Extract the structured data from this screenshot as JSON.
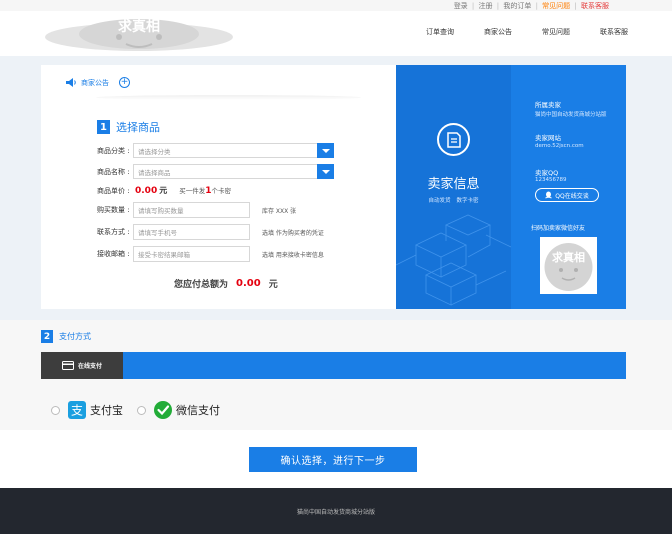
{
  "topbar": {
    "links": [
      "登录",
      "注册",
      "我的订单",
      "常见问题",
      "联系客服"
    ],
    "separator": "|"
  },
  "header": {
    "logo_text": "求真相",
    "nav": [
      "订单查询",
      "商家公告",
      "常见问题",
      "联系客服"
    ]
  },
  "notice": {
    "label": "商家公告",
    "plus": "+"
  },
  "step1": {
    "number": "1",
    "title": "选择商品",
    "category": {
      "label": "商品分类 :",
      "placeholder": "请选择分类"
    },
    "product": {
      "label": "商品名称 :",
      "placeholder": "请选择商品"
    },
    "unit_price": {
      "label": "商品单价 :",
      "value": "0.00",
      "unit": "元",
      "deal_prefix": "买一件发",
      "deal_count": "1",
      "deal_suffix": "个卡密"
    },
    "quantity": {
      "label": "购买数量 :",
      "placeholder": "请填写购买数量",
      "hint": "库存 XXX 张"
    },
    "contact": {
      "label": "联系方式 :",
      "placeholder": "请填写手机号",
      "hint": "选填 作为购买者的凭证"
    },
    "email": {
      "label": "接收邮箱 :",
      "placeholder": "接受卡密结果邮箱",
      "hint": "选填 用来接收卡密信息"
    },
    "total": {
      "prefix": "您应付总额为",
      "amount": "0.00",
      "unit": "元"
    }
  },
  "seller": {
    "title": "卖家信息",
    "tags": [
      "自动发货",
      "数字卡密"
    ],
    "shop_label": "所属卖家",
    "shop_value": "猫尚中国自动发货商城分站版",
    "site_label": "卖家网站",
    "site_value": "demo.52jscn.com",
    "qq_label": "卖家QQ",
    "qq_value": "123456789",
    "qq_button": "QQ在线交谈",
    "wechat_label": "扫码加卖家微信好友",
    "qr_text": "求真相"
  },
  "step2": {
    "number": "2",
    "title": "支付方式",
    "tab": "在线支付",
    "options": [
      {
        "name": "支付宝",
        "icon": "alipay-icon"
      },
      {
        "name": "微信支付",
        "icon": "wechat-pay-icon"
      }
    ]
  },
  "confirm_label": "确认选择，进行下一步",
  "footer_text": "猫尚中国自动发货商城分站版",
  "colors": {
    "accent": "#1a7ee6",
    "price": "#e4000f",
    "footer": "#23272f",
    "highlight": "#ff7d00"
  }
}
